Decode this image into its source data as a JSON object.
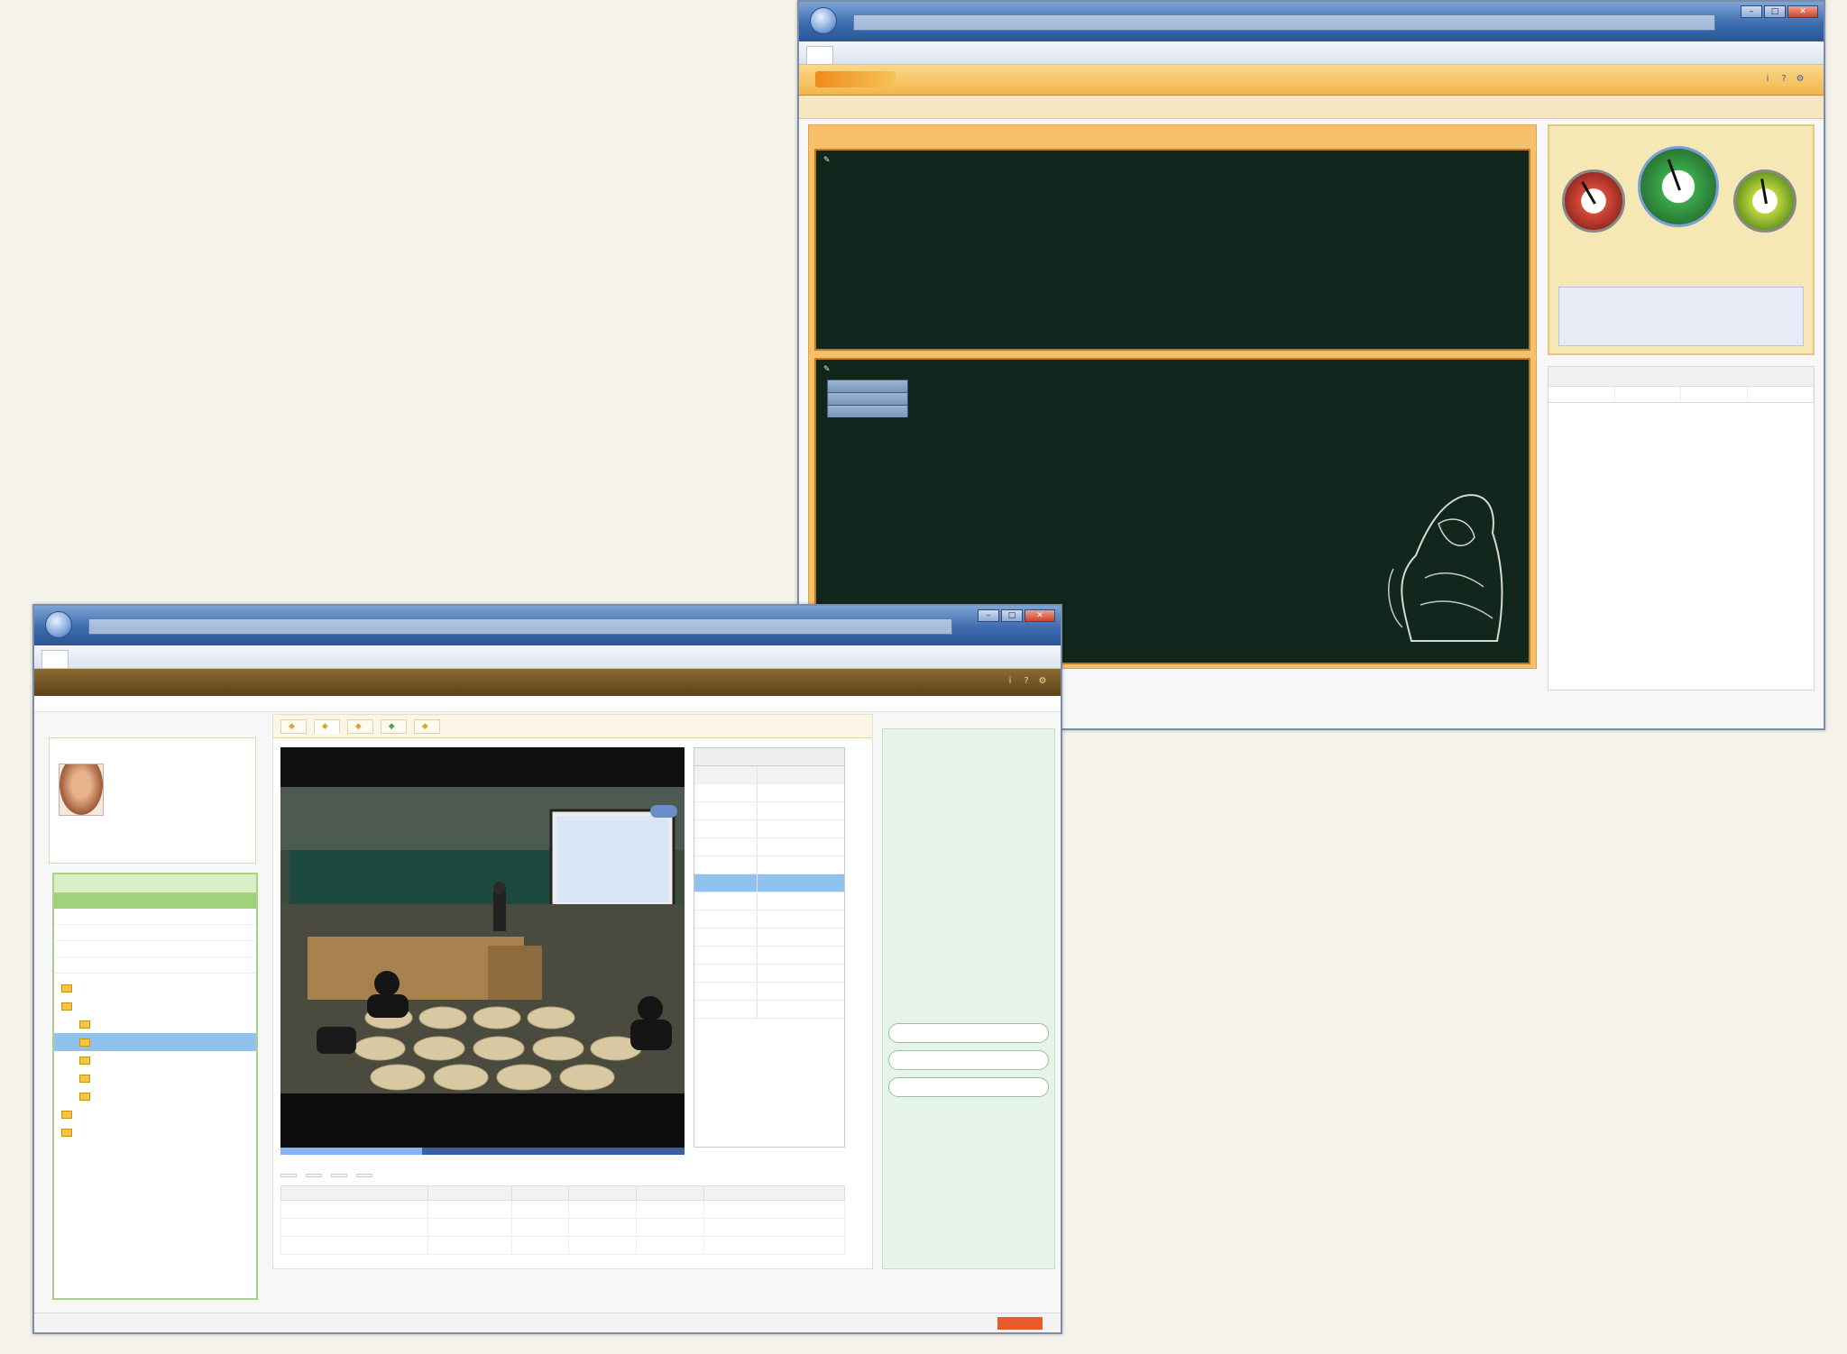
{
  "window_right": {
    "title": "",
    "tab": "",
    "toolbar_link": "",
    "board_top": {
      "title": "",
      "lines": [
        "",
        "",
        ""
      ]
    },
    "board_bottom": {
      "title": "",
      "items": [
        "",
        "",
        ""
      ]
    },
    "gauges": [
      {
        "label": "",
        "color": "#d64a3a",
        "level": 0.2
      },
      {
        "label": "",
        "color": "#3aa84a",
        "level": 0.6
      },
      {
        "label": "",
        "color": "#8ac43a",
        "level": 0.8
      }
    ],
    "notes": "",
    "chat_title": "",
    "chat_columns": [
      "",
      "",
      "",
      ""
    ],
    "chat_first_line": "",
    "bottom_buttons": [
      "",
      ""
    ],
    "copyright": ""
  },
  "window_left": {
    "title": "",
    "tab": "",
    "nav_items": [
      "",
      "",
      ""
    ],
    "profile": {
      "fields": [
        "",
        "",
        "",
        ""
      ],
      "actions": [
        "",
        "",
        ""
      ]
    },
    "tree": {
      "header": "",
      "green_row": [
        "",
        ""
      ],
      "rows": [
        "",
        "",
        "",
        ""
      ],
      "nodes": [
        "",
        "",
        "",
        "",
        "",
        "",
        "",
        "",
        ""
      ]
    },
    "center_tabs": [
      "",
      "",
      "",
      "",
      ""
    ],
    "video": {
      "progress": 0.35
    },
    "list": {
      "header": "",
      "col_headers": [
        "",
        ""
      ],
      "rows": [
        [
          "",
          ""
        ],
        [
          "",
          ""
        ],
        [
          "",
          ""
        ],
        [
          "",
          ""
        ],
        [
          "",
          ""
        ],
        [
          "",
          ""
        ],
        [
          "",
          ""
        ],
        [
          "",
          ""
        ],
        [
          "",
          ""
        ],
        [
          "",
          ""
        ],
        [
          "",
          ""
        ],
        [
          "",
          ""
        ],
        [
          "",
          ""
        ]
      ],
      "selected_index": 5
    },
    "table_buttons": [
      "",
      "",
      "",
      ""
    ],
    "table_columns": [
      "",
      "",
      "",
      "",
      "",
      ""
    ],
    "right_panel": {
      "header": "",
      "subheader": "",
      "paragraphs": [
        "",
        "",
        ""
      ],
      "link": "",
      "section": "",
      "pills": [
        "",
        "",
        ""
      ]
    }
  }
}
